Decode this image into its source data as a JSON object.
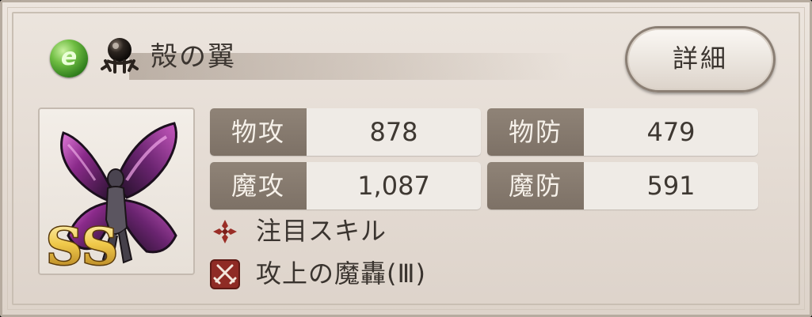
{
  "item": {
    "name": "殻の翼",
    "element_icon": "wind-element-icon",
    "element_glyph": "e",
    "type_icon": "dark-orb-type-icon",
    "rank": "SS"
  },
  "detail_button": {
    "label": "詳細"
  },
  "stats": [
    {
      "label": "物攻",
      "value": "878"
    },
    {
      "label": "物防",
      "value": "479"
    },
    {
      "label": "魔攻",
      "value": "1,087"
    },
    {
      "label": "魔防",
      "value": "591"
    }
  ],
  "skills": {
    "featured": {
      "icon": "red-cross-skill-icon",
      "label": "注目スキル"
    },
    "skill": {
      "icon": "crossed-swords-skill-icon",
      "label": "攻上の魔轟(Ⅲ)"
    }
  },
  "colors": {
    "stat_label_bg": "#85796e",
    "skill_icon_red": "#8f2b25",
    "wing_purple": "#8a2a8a"
  }
}
